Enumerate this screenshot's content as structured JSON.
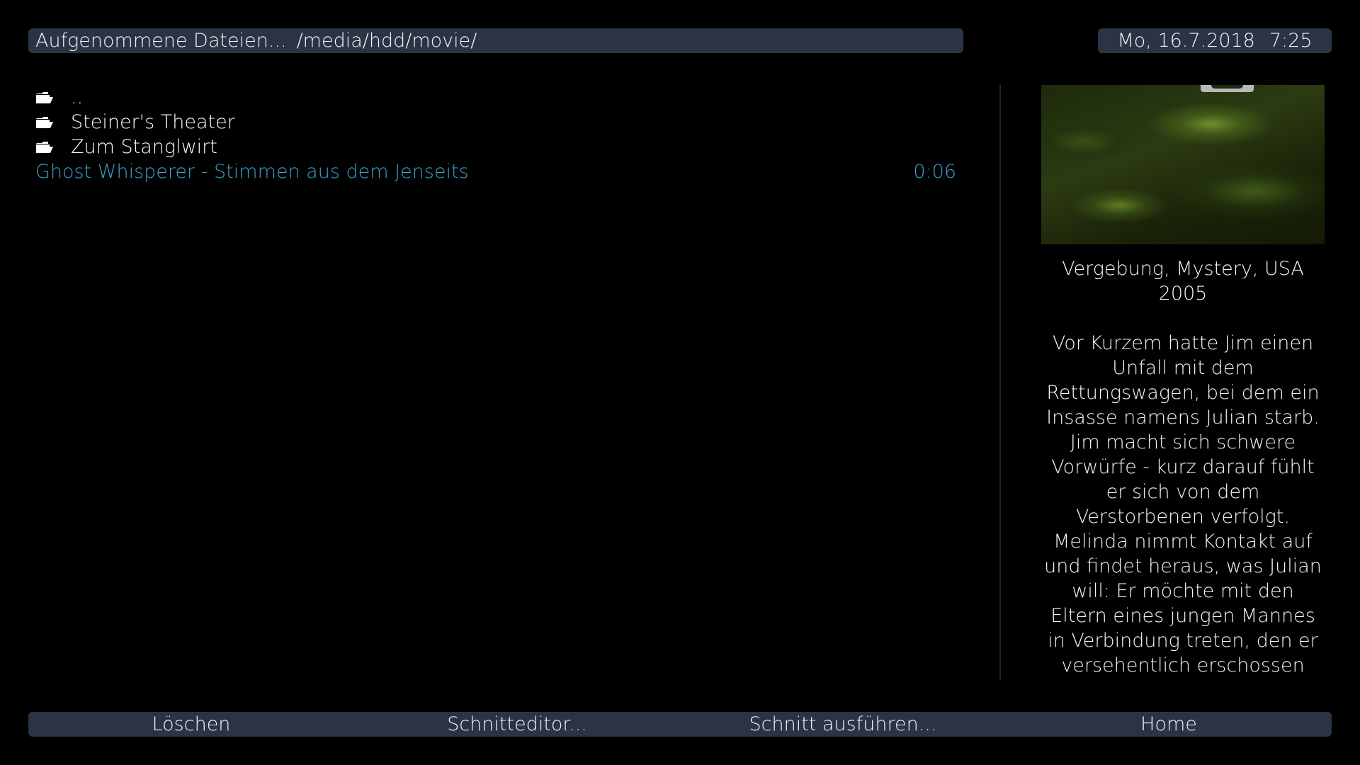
{
  "header": {
    "title": "Aufgenommene Dateien...",
    "path": "/media/hdd/movie/",
    "date": "Mo, 16.7.2018",
    "time": "7:25"
  },
  "file_list": {
    "entries": [
      {
        "type": "folder",
        "icon": "folder-icon",
        "name": ".."
      },
      {
        "type": "folder",
        "icon": "folder-icon",
        "name": "Steiner's Theater"
      },
      {
        "type": "folder",
        "icon": "folder-icon",
        "name": "Zum Stanglwirt"
      },
      {
        "type": "movie",
        "name": "Ghost Whisperer - Stimmen aus dem Jenseits",
        "duration": "0:06",
        "selected": true
      }
    ]
  },
  "details": {
    "genre_line": "Vergebung, Mystery, USA",
    "year": "2005",
    "description": "Vor Kurzem hatte Jim einen Unfall mit dem Rettungswagen, bei dem ein Insasse namens Julian starb. Jim macht sich schwere Vorwürfe - kurz darauf fühlt er sich von dem Verstorbenen verfolgt. Melinda nimmt Kontakt auf und findet heraus, was Julian will: Er möchte mit den Eltern eines jungen Mannes in Verbindung treten, den er versehentlich erschossen hat, und um"
  },
  "buttons": {
    "red": "Löschen",
    "green": "Schnitteditor...",
    "yellow": "Schnitt ausführen...",
    "blue": "Home"
  },
  "colors": {
    "bar_background": "#2b3445",
    "selected_text": "#3aa0c8",
    "background": "#000000"
  }
}
